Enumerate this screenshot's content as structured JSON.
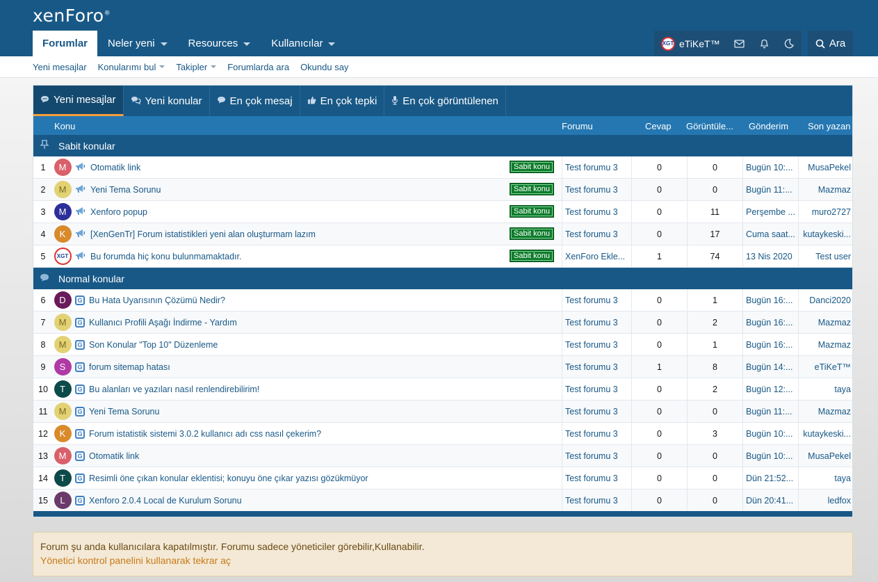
{
  "header": {
    "logo": "xenForo",
    "nav": [
      {
        "label": "Forumlar",
        "active": true,
        "has_menu": false
      },
      {
        "label": "Neler yeni",
        "active": false,
        "has_menu": true
      },
      {
        "label": "Resources",
        "active": false,
        "has_menu": true
      },
      {
        "label": "Kullanıcılar",
        "active": false,
        "has_menu": true
      }
    ],
    "user": {
      "name": "eTiKeT™",
      "avatar_text": "XGT"
    },
    "search_label": "Ara"
  },
  "subnav": [
    {
      "label": "Yeni mesajlar",
      "has_menu": false
    },
    {
      "label": "Konularımı bul",
      "has_menu": true
    },
    {
      "label": "Takipler",
      "has_menu": true
    },
    {
      "label": "Forumlarda ara",
      "has_menu": false
    },
    {
      "label": "Okundu say",
      "has_menu": false
    }
  ],
  "tabs": [
    {
      "label": "Yeni mesajlar",
      "active": true,
      "icon": "message-dots-icon"
    },
    {
      "label": "Yeni konular",
      "active": false,
      "icon": "comments-icon"
    },
    {
      "label": "En çok mesaj",
      "active": false,
      "icon": "comment-icon"
    },
    {
      "label": "En çok tepki",
      "active": false,
      "icon": "thumbs-up-icon"
    },
    {
      "label": "En çok görüntülenen",
      "active": false,
      "icon": "microphone-icon"
    }
  ],
  "columns": {
    "topic": "Konu",
    "forum": "Forumu",
    "replies": "Cevap",
    "views": "Görüntüle...",
    "date": "Gönderim",
    "last": "Son yazan"
  },
  "sticky_section": "Sabit konular",
  "normal_section": "Normal konular",
  "sticky_badge": "Sabit konu",
  "sticky_rows": [
    {
      "n": "1",
      "avatar": "M",
      "color": "#d9606a",
      "title": "Otomatik link",
      "forum": "Test forumu 3",
      "replies": "0",
      "views": "0",
      "date": "Bugün 10:...",
      "last": "MusaPekel"
    },
    {
      "n": "2",
      "avatar": "M",
      "color": "#e2d274",
      "title": "Yeni Tema Sorunu",
      "forum": "Test forumu 3",
      "replies": "0",
      "views": "0",
      "date": "Bugün 11:...",
      "last": "Mazmaz"
    },
    {
      "n": "3",
      "avatar": "M",
      "color": "#2c2f9a",
      "title": "Xenforo popup",
      "forum": "Test forumu 3",
      "replies": "0",
      "views": "11",
      "date": "Perşembe ...",
      "last": "muro2727"
    },
    {
      "n": "4",
      "avatar": "K",
      "color": "#d98a2a",
      "title": "[XenGenTr] Forum istatistikleri yeni alan oluşturmam lazım",
      "forum": "Test forumu 3",
      "replies": "0",
      "views": "17",
      "date": "Cuma saat...",
      "last": "kutaykeski..."
    },
    {
      "n": "5",
      "avatar": "XGT",
      "color": "#ffffff",
      "title": "Bu forumda hiç konu bulunmamaktadır.",
      "forum": "XenForo Ekle...",
      "replies": "1",
      "views": "74",
      "date": "13 Nis 2020",
      "last": "Test user"
    }
  ],
  "normal_rows": [
    {
      "n": "6",
      "avatar": "D",
      "color": "#6a1a5a",
      "title": "Bu Hata Uyarısının Çözümü Nedir?",
      "forum": "Test forumu 3",
      "replies": "0",
      "views": "1",
      "date": "Bugün 16:...",
      "last": "Danci2020"
    },
    {
      "n": "7",
      "avatar": "M",
      "color": "#e2d274",
      "title": "Kullanıcı Profili Aşağı İndirme - Yardım",
      "forum": "Test forumu 3",
      "replies": "0",
      "views": "2",
      "date": "Bugün 16:...",
      "last": "Mazmaz"
    },
    {
      "n": "8",
      "avatar": "M",
      "color": "#e2d274",
      "title": "Son Konular \"Top 10\" Düzenleme",
      "forum": "Test forumu 3",
      "replies": "0",
      "views": "1",
      "date": "Bugün 16:...",
      "last": "Mazmaz"
    },
    {
      "n": "9",
      "avatar": "S",
      "color": "#b03aa5",
      "title": "forum sitemap hatası",
      "forum": "Test forumu 3",
      "replies": "1",
      "views": "8",
      "date": "Bugün 14:...",
      "last": "eTiKeT™"
    },
    {
      "n": "10",
      "avatar": "T",
      "color": "#0d4a4a",
      "title": "Bu alanları ve yazıları nasıl renlendirebilirim!",
      "forum": "Test forumu 3",
      "replies": "0",
      "views": "2",
      "date": "Bugün 12:...",
      "last": "taya"
    },
    {
      "n": "11",
      "avatar": "M",
      "color": "#e2d274",
      "title": "Yeni Tema Sorunu",
      "forum": "Test forumu 3",
      "replies": "0",
      "views": "0",
      "date": "Bugün 11:...",
      "last": "Mazmaz"
    },
    {
      "n": "12",
      "avatar": "K",
      "color": "#d98a2a",
      "title": "Forum istatistik sistemi 3.0.2 kullanıcı adı css nasıl çekerim?",
      "forum": "Test forumu 3",
      "replies": "0",
      "views": "3",
      "date": "Bugün 10:...",
      "last": "kutaykeski..."
    },
    {
      "n": "13",
      "avatar": "M",
      "color": "#d9606a",
      "title": "Otomatik link",
      "forum": "Test forumu 3",
      "replies": "0",
      "views": "0",
      "date": "Bugün 10:...",
      "last": "MusaPekel"
    },
    {
      "n": "14",
      "avatar": "T",
      "color": "#0d4a4a",
      "title": "Resimli öne çıkan konular eklentisi; konuyu öne çıkar yazısı gözükmüyor",
      "forum": "Test forumu 3",
      "replies": "0",
      "views": "0",
      "date": "Dün 21:52...",
      "last": "taya"
    },
    {
      "n": "15",
      "avatar": "L",
      "color": "#6a3a6a",
      "title": "Xenforo 2.0.4 Local de Kurulum Sorunu",
      "forum": "Test forumu 3",
      "replies": "0",
      "views": "0",
      "date": "Dün 20:41...",
      "last": "ledfox"
    }
  ],
  "notice": {
    "text": "Forum şu anda kullanıcılara kapatılmıştır. Forumu sadece yöneticiler görebilir,Kullanabilir.",
    "link": "Yönetici kontrol panelini kullanarak tekrar aç"
  }
}
